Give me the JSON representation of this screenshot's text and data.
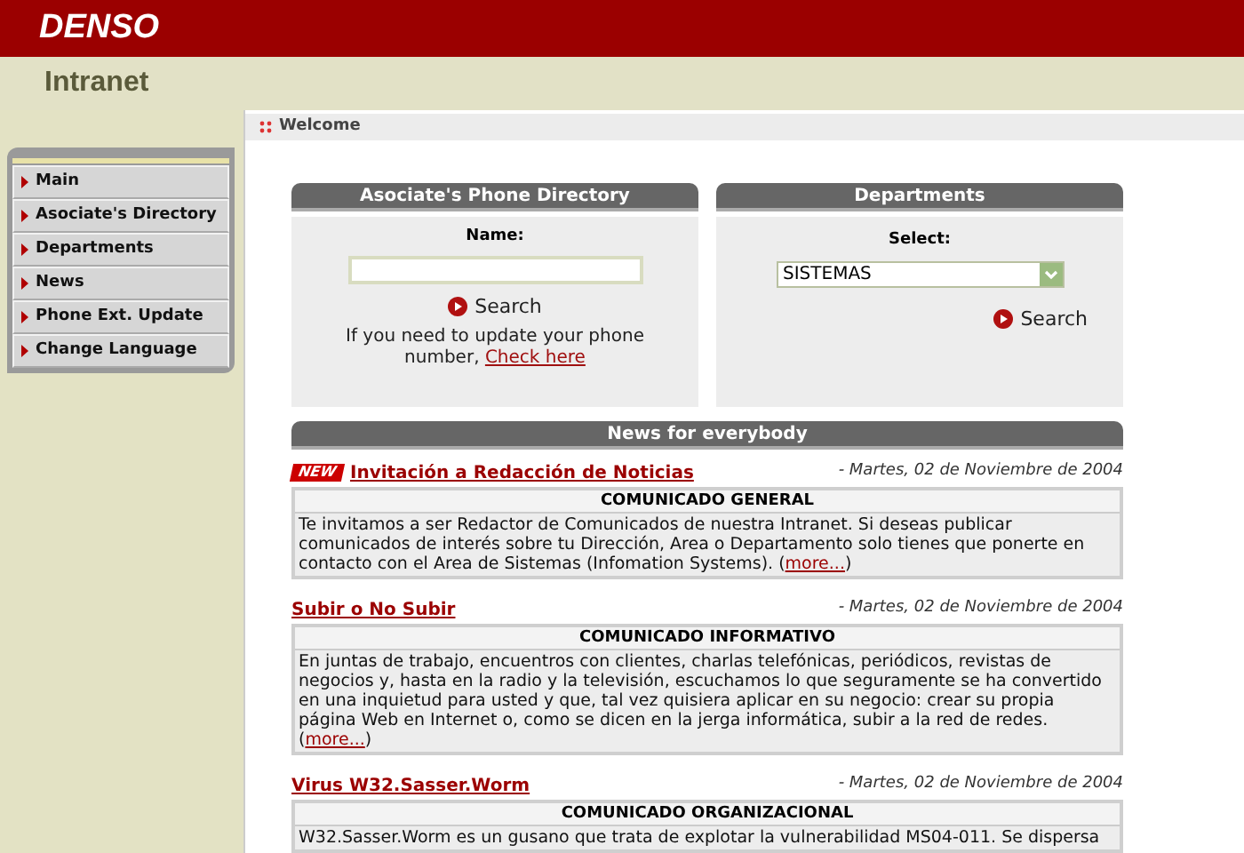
{
  "brand": "DENSO",
  "site_title": "Intranet",
  "breadcrumb": "Welcome",
  "menu": [
    {
      "label": "Main"
    },
    {
      "label": "Asociate's Directory"
    },
    {
      "label": "Departments"
    },
    {
      "label": "News"
    },
    {
      "label": "Phone Ext. Update"
    },
    {
      "label": "Change Language"
    }
  ],
  "phone_directory": {
    "title": "Asociate's Phone Directory",
    "name_label": "Name:",
    "search_button": "Search",
    "note": "If you need to update your phone number,",
    "note_link": "Check here"
  },
  "departments": {
    "title": "Departments",
    "select_label": "Select:",
    "selected_value": "SISTEMAS",
    "search_button": "Search"
  },
  "news": {
    "title": "News for everybody",
    "items": [
      {
        "badge": "NEW",
        "title": "Invitación a Redacción de Noticias",
        "date": "- Martes, 02 de Noviembre de 2004",
        "category": "COMUNICADO GENERAL",
        "body": "Te invitamos a ser Redactor de Comunicados de nuestra Intranet. Si deseas publicar comunicados de interés sobre tu Dirección, Area o Departamento solo tienes que ponerte en contacto con el Area de Sistemas (Infomation Systems).",
        "more_open": "(",
        "more_link": "more...",
        "more_close": ")"
      },
      {
        "title": "Subir o No Subir",
        "date": "- Martes, 02 de Noviembre de 2004",
        "category": "COMUNICADO INFORMATIVO",
        "body": "En juntas de trabajo, encuentros con clientes, charlas telefónicas, periódicos, revistas de negocios y, hasta en la radio y la televisión, escuchamos lo que seguramente se ha convertido en una inquietud para usted y que, tal vez quisiera aplicar en su negocio: crear su propia página Web en Internet o, como se dicen en la jerga informática, subir a la red de redes.",
        "more_open": "(",
        "more_link": "more...",
        "more_close": ")"
      },
      {
        "title": "Virus W32.Sasser.Worm",
        "date": "- Martes, 02 de Noviembre de 2004",
        "category": "COMUNICADO ORGANIZACIONAL",
        "body": "W32.Sasser.Worm es un gusano que trata de explotar la vulnerabilidad MS04-011. Se dispersa"
      }
    ]
  }
}
